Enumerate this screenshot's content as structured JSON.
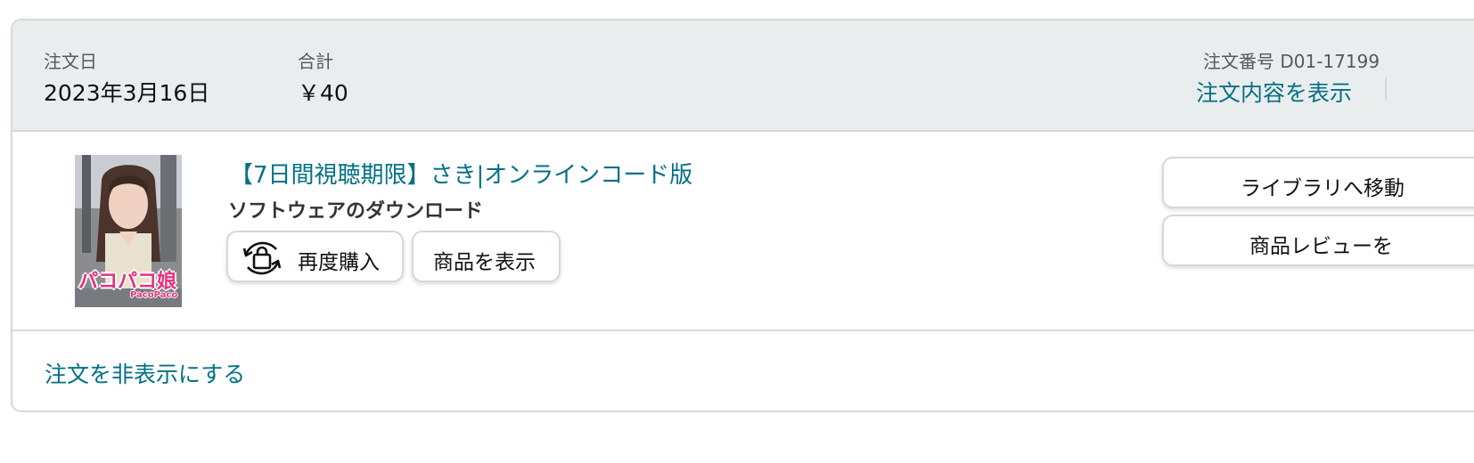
{
  "header": {
    "order_date_label": "注文日",
    "order_date_value": "2023年3月16日",
    "total_label": "合計",
    "total_value": "￥40",
    "order_number_text": "注文番号 D01-17199",
    "order_details_link": "注文内容を表示"
  },
  "item": {
    "title": "【7日間視聴期限】さき|オンラインコード版",
    "type": "ソフトウェアのダウンロード",
    "thumbnail_logo_text": "パコパコ娘",
    "thumbnail_logo_subtext": "PacoPaco",
    "buy_again_label": "再度購入",
    "view_item_label": "商品を表示",
    "buy_again_icon": "repurchase-bag-icon"
  },
  "actions": {
    "library_label": "ライブラリへ移動",
    "review_label": "商品レビューを"
  },
  "footer": {
    "hide_order_label": "注文を非表示にする"
  },
  "colors": {
    "link": "#007185",
    "header_bg": "#eaedee",
    "border": "#d5d9d9",
    "logo_pink": "#e8317a"
  }
}
